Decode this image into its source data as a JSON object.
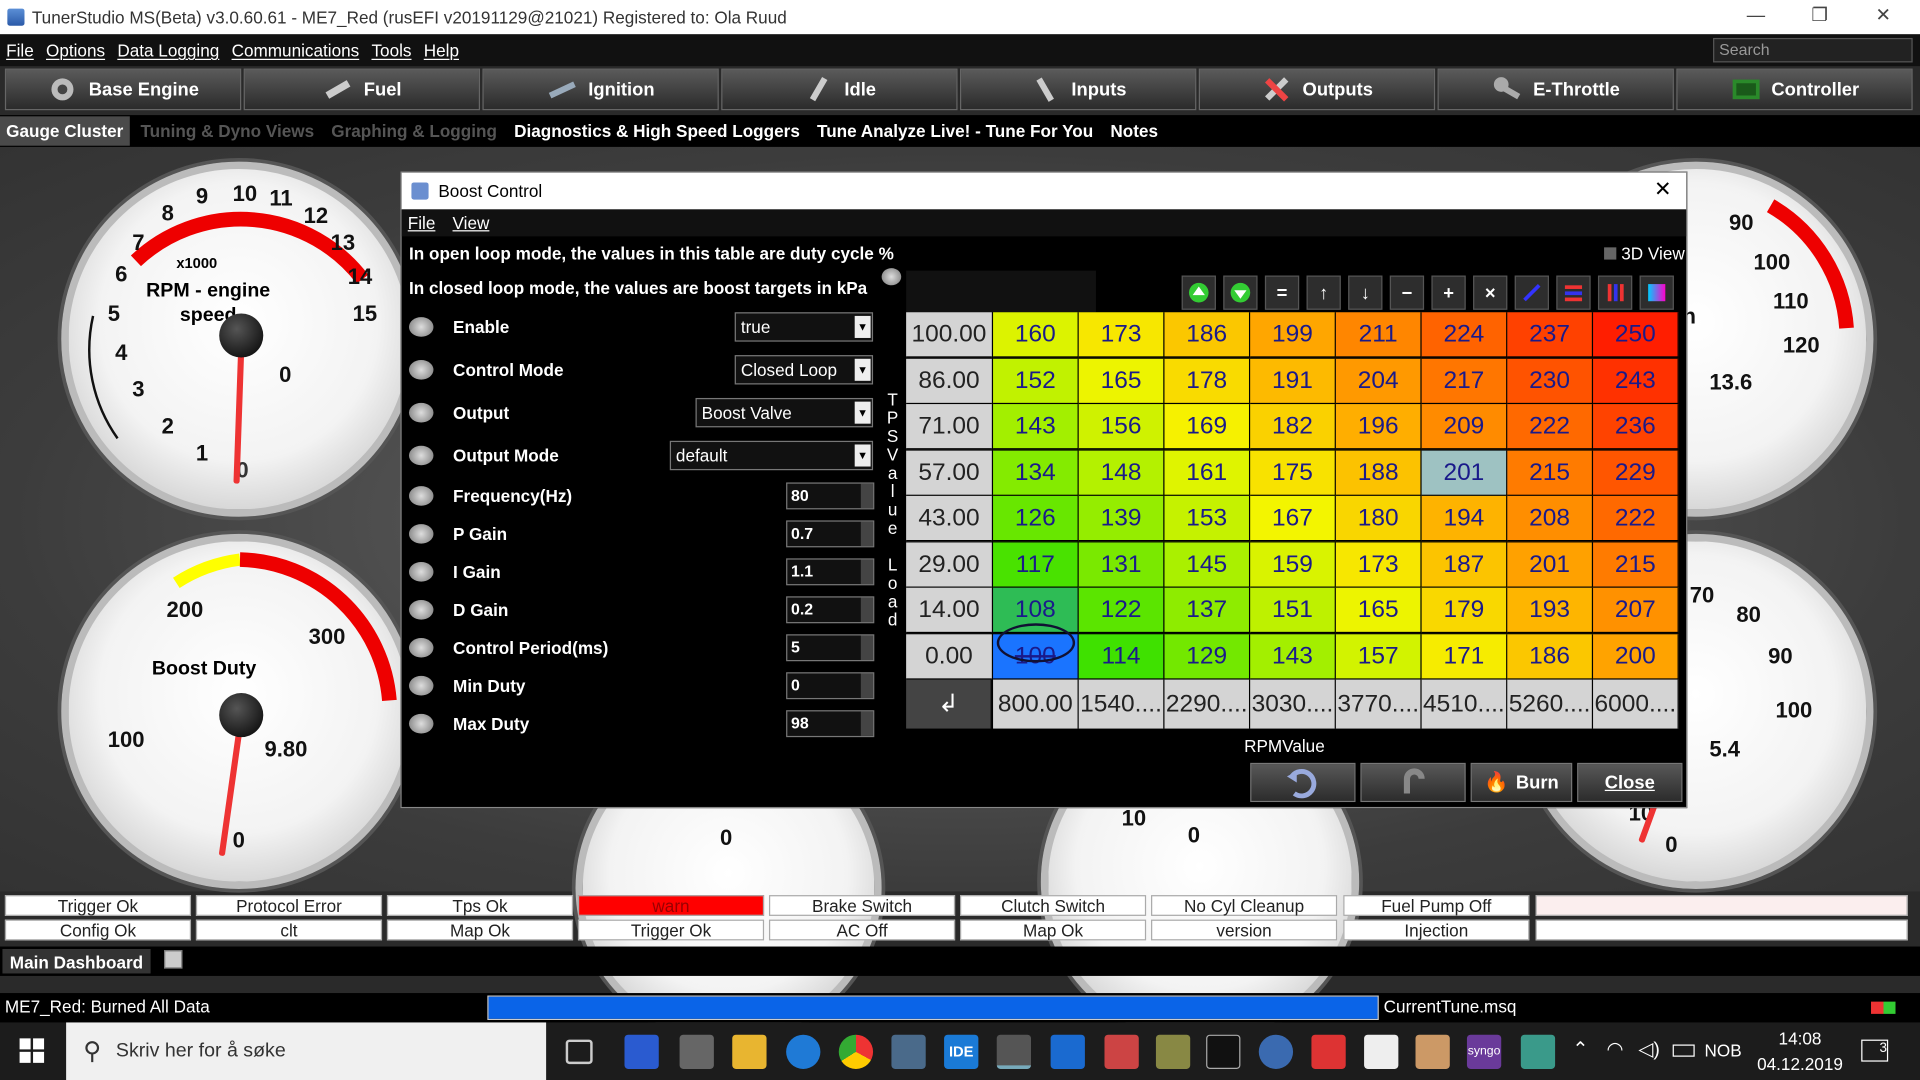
{
  "window": {
    "title": "TunerStudio MS(Beta) v3.0.60.61 - ME7_Red (rusEFI v20191129@21021) Registered to: Ola Ruud",
    "min": "—",
    "max": "❐",
    "close": "✕"
  },
  "menu": [
    "File",
    "Options",
    "Data Logging",
    "Communications",
    "Tools",
    "Help"
  ],
  "search_placeholder": "Search",
  "nav": [
    "Base Engine",
    "Fuel",
    "Ignition",
    "Idle",
    "Inputs",
    "Outputs",
    "E-Throttle",
    "Controller"
  ],
  "tabs": [
    "Gauge Cluster",
    "Tuning & Dyno Views",
    "Graphing & Logging",
    "Diagnostics & High Speed Loggers",
    "Tune Analyze Live! - Tune For You",
    "Notes"
  ],
  "gauges": {
    "rpm": {
      "title": "RPM - engine speed",
      "mult": "x1000",
      "ticks": [
        "0",
        "1",
        "2",
        "3",
        "4",
        "5",
        "6",
        "7",
        "8",
        "9",
        "10",
        "11",
        "12",
        "13",
        "14",
        "15"
      ],
      "value": "0"
    },
    "boost": {
      "title": "Boost Duty",
      "ticks": [
        "0",
        "100",
        "200",
        "300"
      ],
      "value": "9.80"
    },
    "right_top": {
      "ticks": [
        "90",
        "100",
        "110",
        "120"
      ],
      "value": "13.6",
      "partial": "n"
    },
    "right_bot": {
      "ticks": [
        "70",
        "80",
        "90",
        "100"
      ],
      "value": "5.4"
    },
    "bottom": {
      "ticks": [
        "0",
        "10",
        "0",
        "10",
        "0"
      ]
    }
  },
  "dialog": {
    "title": "Boost Control",
    "close": "✕",
    "menu": [
      "File",
      "View"
    ],
    "info1": "In open loop mode, the values in this table are duty cycle %",
    "info2": "In closed loop mode, the values are boost targets in kPa",
    "fields": [
      {
        "label": "Enable",
        "value": "true"
      },
      {
        "label": "Control Mode",
        "value": "Closed Loop"
      },
      {
        "label": "Output",
        "value": "Boost Valve"
      },
      {
        "label": "Output Mode",
        "value": "default"
      },
      {
        "label": "Frequency(Hz)",
        "value": "80"
      },
      {
        "label": "P Gain",
        "value": "0.7"
      },
      {
        "label": "I Gain",
        "value": "1.1"
      },
      {
        "label": "D Gain",
        "value": "0.2"
      },
      {
        "label": "Control Period(ms)",
        "value": "5"
      },
      {
        "label": "Min Duty",
        "value": "0"
      },
      {
        "label": "Max Duty",
        "value": "98"
      }
    ],
    "view3d": "3D View",
    "ylabel": "TPSValue Load",
    "xlabel": "RPMValue",
    "y": [
      "100.00",
      "86.00",
      "71.00",
      "57.00",
      "43.00",
      "29.00",
      "14.00",
      "0.00"
    ],
    "x": [
      "800.00",
      "1540....",
      "2290....",
      "3030....",
      "3770....",
      "4510....",
      "5260....",
      "6000...."
    ],
    "corner": "↲",
    "table": [
      [
        160,
        173,
        186,
        199,
        211,
        224,
        237,
        250
      ],
      [
        152,
        165,
        178,
        191,
        204,
        217,
        230,
        243
      ],
      [
        143,
        156,
        169,
        182,
        196,
        209,
        222,
        236
      ],
      [
        134,
        148,
        161,
        175,
        188,
        201,
        215,
        229
      ],
      [
        126,
        139,
        153,
        167,
        180,
        194,
        208,
        222
      ],
      [
        117,
        131,
        145,
        159,
        173,
        187,
        201,
        215
      ],
      [
        108,
        122,
        137,
        151,
        165,
        179,
        193,
        207
      ],
      [
        100,
        114,
        129,
        143,
        157,
        171,
        186,
        200
      ]
    ],
    "buttons": {
      "burn": "Burn",
      "close": "Close"
    }
  },
  "status_row1": [
    "Trigger Ok",
    "Protocol Error",
    "Tps Ok",
    "warn",
    "Brake Switch",
    "Clutch Switch",
    "No Cyl Cleanup",
    "Fuel Pump Off",
    ""
  ],
  "status_row2": [
    "Config Ok",
    "clt",
    "Map Ok",
    "Trigger Ok",
    "AC Off",
    "Map Ok",
    "version",
    "Injection",
    ""
  ],
  "dashboard_tab": "Main Dashboard",
  "status": {
    "msg": "ME7_Red: Burned All Data",
    "file": "CurrentTune.msq",
    "progress": 1.0
  },
  "taskbar": {
    "search": "Skriv her for å søke",
    "lang": "NOB",
    "time": "14:08",
    "date": "04.12.2019",
    "notif": "3"
  },
  "colors": {
    "cell_red": "#ff2a00",
    "cell_yellow": "#f5f500",
    "cell_green": "#38e000",
    "cell_blue": "#1a74ff",
    "warn": "#ff0000"
  }
}
